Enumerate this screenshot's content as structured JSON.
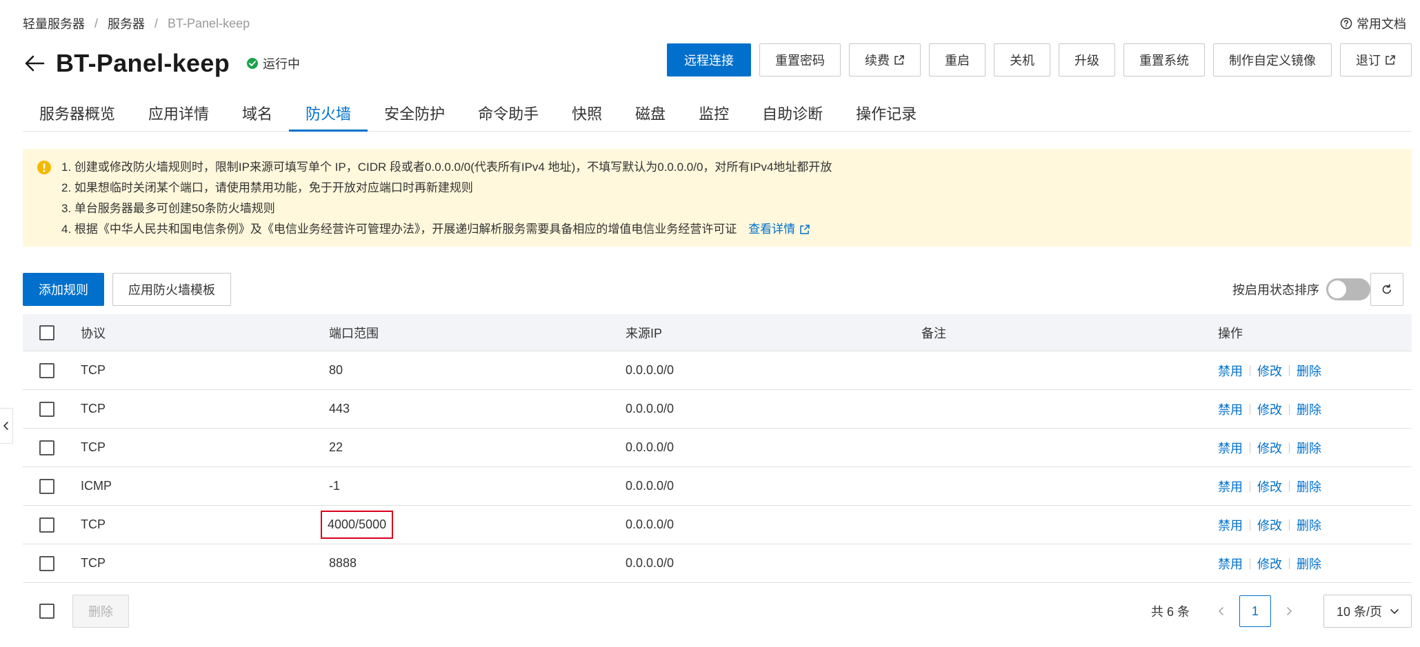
{
  "breadcrumb": {
    "items": [
      "轻量服务器",
      "服务器",
      "BT-Panel-keep"
    ],
    "separator": "/"
  },
  "help": {
    "label": "常用文档"
  },
  "header": {
    "title": "BT-Panel-keep",
    "status": "运行中"
  },
  "actions": {
    "remote_connect": "远程连接",
    "reset_password": "重置密码",
    "renew": "续费",
    "restart": "重启",
    "shutdown": "关机",
    "upgrade": "升级",
    "reset_system": "重置系统",
    "custom_image": "制作自定义镜像",
    "unsubscribe": "退订"
  },
  "tabs": [
    "服务器概览",
    "应用详情",
    "域名",
    "防火墙",
    "安全防护",
    "命令助手",
    "快照",
    "磁盘",
    "监控",
    "自助诊断",
    "操作记录"
  ],
  "active_tab": "防火墙",
  "notice": {
    "lines": [
      "1. 创建或修改防火墙规则时，限制IP来源可填写单个 IP，CIDR 段或者0.0.0.0/0(代表所有IPv4 地址)，不填写默认为0.0.0.0/0，对所有IPv4地址都开放",
      "2. 如果想临时关闭某个端口，请使用禁用功能，免于开放对应端口时再新建规则",
      "3. 单台服务器最多可创建50条防火墙规则",
      "4. 根据《中华人民共和国电信条例》及《电信业务经营许可管理办法》，开展递归解析服务需要具备相应的增值电信业务经营许可证"
    ],
    "link": "查看详情"
  },
  "toolbar": {
    "add_rule": "添加规则",
    "apply_template": "应用防火墙模板",
    "sort_label": "按启用状态排序"
  },
  "table": {
    "columns": {
      "protocol": "协议",
      "port": "端口范围",
      "source": "来源IP",
      "note": "备注",
      "ops": "操作"
    },
    "ops_labels": {
      "disable": "禁用",
      "edit": "修改",
      "delete": "删除"
    },
    "rows": [
      {
        "protocol": "TCP",
        "port": "80",
        "source": "0.0.0.0/0",
        "note": ""
      },
      {
        "protocol": "TCP",
        "port": "443",
        "source": "0.0.0.0/0",
        "note": ""
      },
      {
        "protocol": "TCP",
        "port": "22",
        "source": "0.0.0.0/0",
        "note": ""
      },
      {
        "protocol": "ICMP",
        "port": "-1",
        "source": "0.0.0.0/0",
        "note": ""
      },
      {
        "protocol": "TCP",
        "port": "4000/5000",
        "source": "0.0.0.0/0",
        "note": ""
      },
      {
        "protocol": "TCP",
        "port": "8888",
        "source": "0.0.0.0/0",
        "note": ""
      }
    ]
  },
  "footer": {
    "delete": "删除",
    "total": "共 6 条",
    "current_page": "1",
    "page_size": "10 条/页"
  },
  "colors": {
    "primary": "#0070cc",
    "notice_bg": "#fff8dc",
    "running": "#1aa34a",
    "highlight": "#d9001b"
  }
}
